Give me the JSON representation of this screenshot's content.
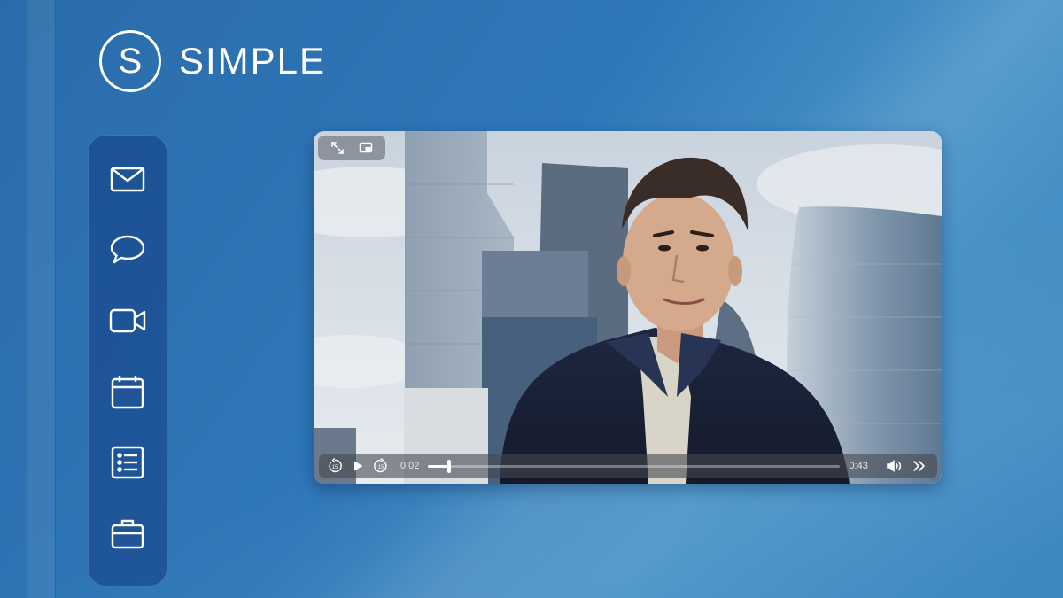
{
  "brand": {
    "logo_letter": "S",
    "name": "SIMPLE"
  },
  "sidebar": {
    "items": [
      {
        "name": "mail",
        "icon": "envelope-icon"
      },
      {
        "name": "chat",
        "icon": "speech-bubble-icon"
      },
      {
        "name": "video",
        "icon": "video-camera-icon"
      },
      {
        "name": "calendar",
        "icon": "calendar-icon"
      },
      {
        "name": "list",
        "icon": "list-icon"
      },
      {
        "name": "work",
        "icon": "briefcase-icon"
      }
    ]
  },
  "player": {
    "top_controls": [
      "fullscreen-icon",
      "picture-in-picture-icon"
    ],
    "current_time": "0:02",
    "duration": "0:43",
    "progress": 0.05,
    "controls": [
      "skip-back-15-icon",
      "play-icon",
      "skip-forward-15-icon",
      "volume-icon",
      "more-icon"
    ],
    "skip_back_label": "15",
    "skip_forward_label": "15"
  },
  "colors": {
    "background": "#2f78b8",
    "sidebar": "#1b4d8e",
    "accent": "#ffffff"
  }
}
